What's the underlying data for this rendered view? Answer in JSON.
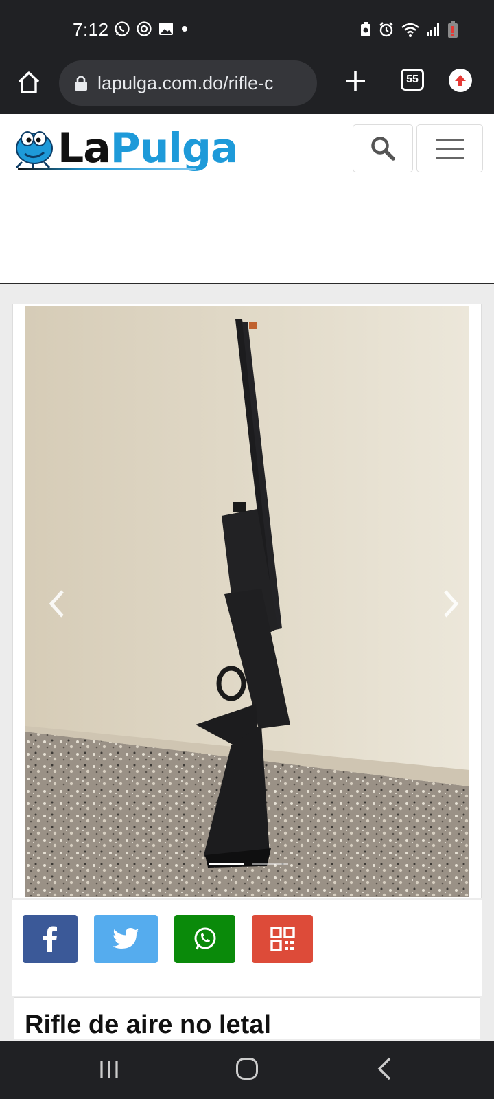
{
  "status_bar": {
    "time": "7:12",
    "left_icons": [
      "whatsapp-icon",
      "sync-icon",
      "image-icon",
      "dot-icon"
    ],
    "right_icons": [
      "battery-saver-icon",
      "alarm-icon",
      "wifi-icon",
      "signal-icon",
      "battery-icon"
    ]
  },
  "browser": {
    "url": "lapulga.com.do/rifle-c",
    "tab_count": "55"
  },
  "site": {
    "logo_la": "La",
    "logo_pulga": "Pulga",
    "brand_color": "#1e9ad9"
  },
  "carousel": {
    "slide_count": 2,
    "active_index": 0
  },
  "share": {
    "facebook_color": "#3b5998",
    "twitter_color": "#55acee",
    "whatsapp_color": "#0a8a0a",
    "qr_color": "#dd4b39"
  },
  "listing": {
    "title": "Rifle de aire no letal"
  }
}
